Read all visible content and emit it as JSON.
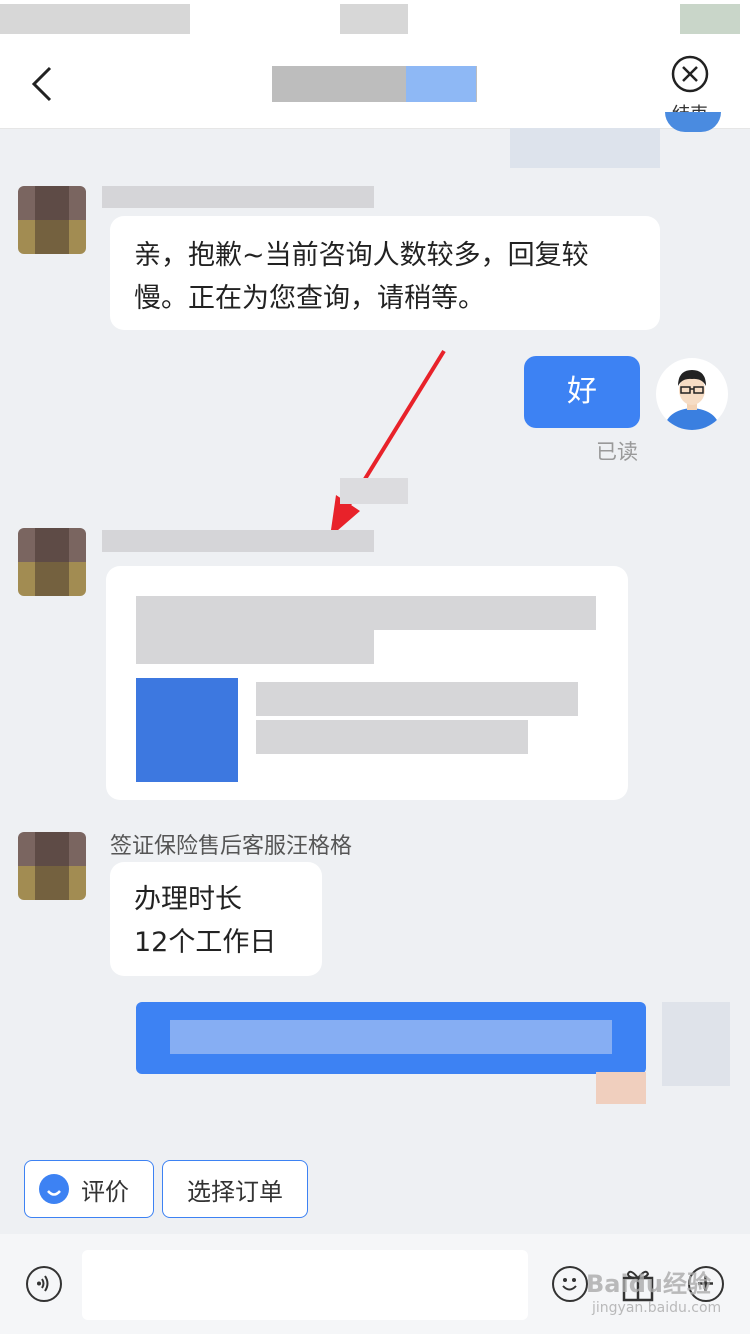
{
  "nav": {
    "end_label": "结束"
  },
  "messages": {
    "agent_reply_1": "亲，抱歉~当前咨询人数较多，回复较慢。正在为您查询，请稍等。",
    "user_reply": "好",
    "user_read_status": "已读",
    "agent3_name": "签证保险售后客服汪格格",
    "agent3_line1": "办理时长",
    "agent3_line2": "12个工作日"
  },
  "chips": {
    "rate": "评价",
    "select_order": "选择订单"
  },
  "watermark": {
    "logo": "Baidu经验",
    "url": "jingyan.baidu.com"
  },
  "colors": {
    "accent": "#3d82f3",
    "background": "#eef0f3"
  },
  "icons": {
    "back": "chevron-left-icon",
    "end": "close-circle-icon",
    "voice": "voice-icon",
    "emoji": "emoji-icon",
    "gift": "gift-icon",
    "add": "add-icon"
  }
}
